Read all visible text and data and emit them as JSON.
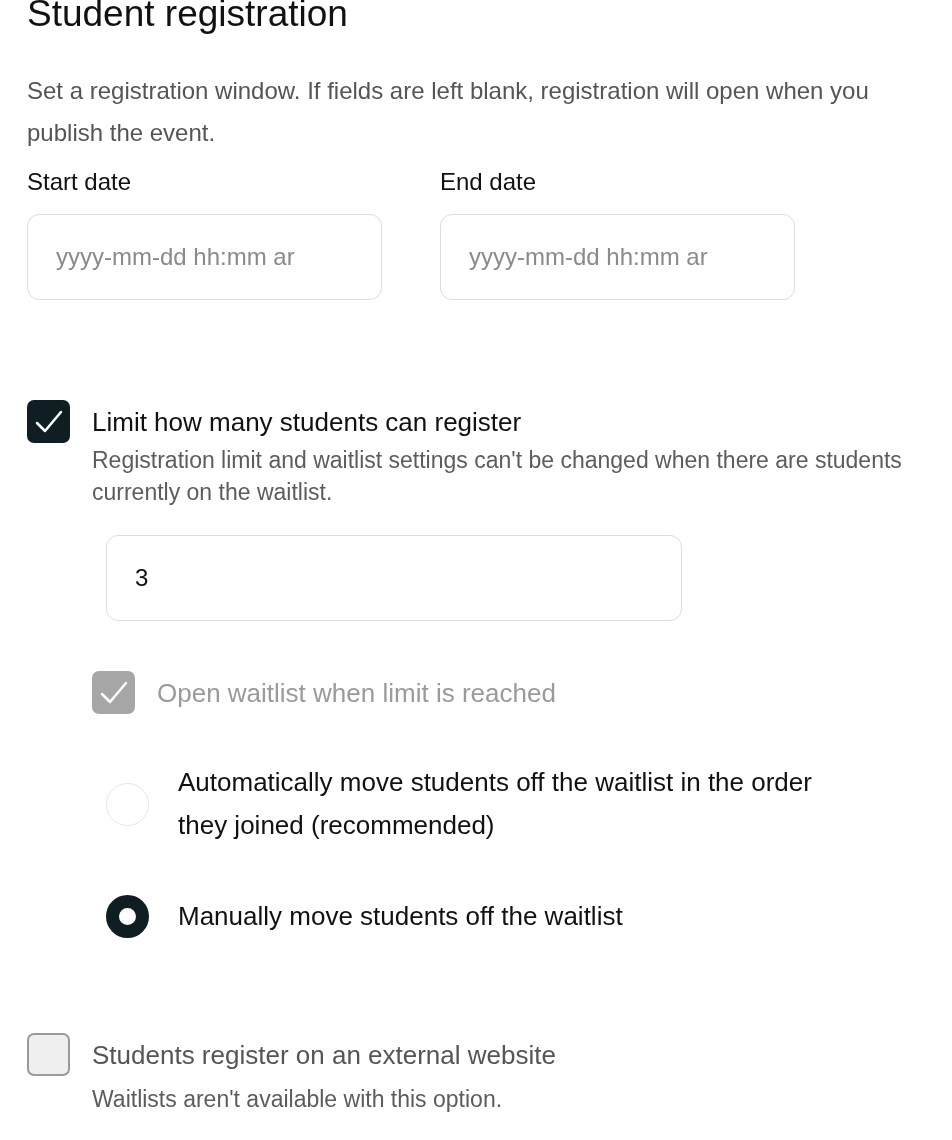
{
  "title": "Student registration",
  "description": "Set a registration window. If fields are left blank, registration will open when you publish the event.",
  "date_fields": [
    {
      "label": "Start date",
      "placeholder": "yyyy-mm-dd hh:mm ar"
    },
    {
      "label": "End date",
      "placeholder": "yyyy-mm-dd hh:mm ar"
    }
  ],
  "limit": {
    "label": "Limit how many students can register",
    "checked": true,
    "disabled": false,
    "help": "Registration limit and waitlist settings can't be changed when there are students currently on the waitlist.",
    "value": "3"
  },
  "waitlist": {
    "label": "Open waitlist when limit is reached",
    "checked": true,
    "disabled": true
  },
  "waitlist_options": [
    {
      "label": "Automatically move students off the waitlist in the order they joined (recommended)",
      "selected": false
    },
    {
      "label": "Manually move students off the waitlist",
      "selected": true
    }
  ],
  "external": {
    "label": "Students register on an external website",
    "checked": false,
    "disabled": false,
    "help": "Waitlists aren't available with this option."
  }
}
